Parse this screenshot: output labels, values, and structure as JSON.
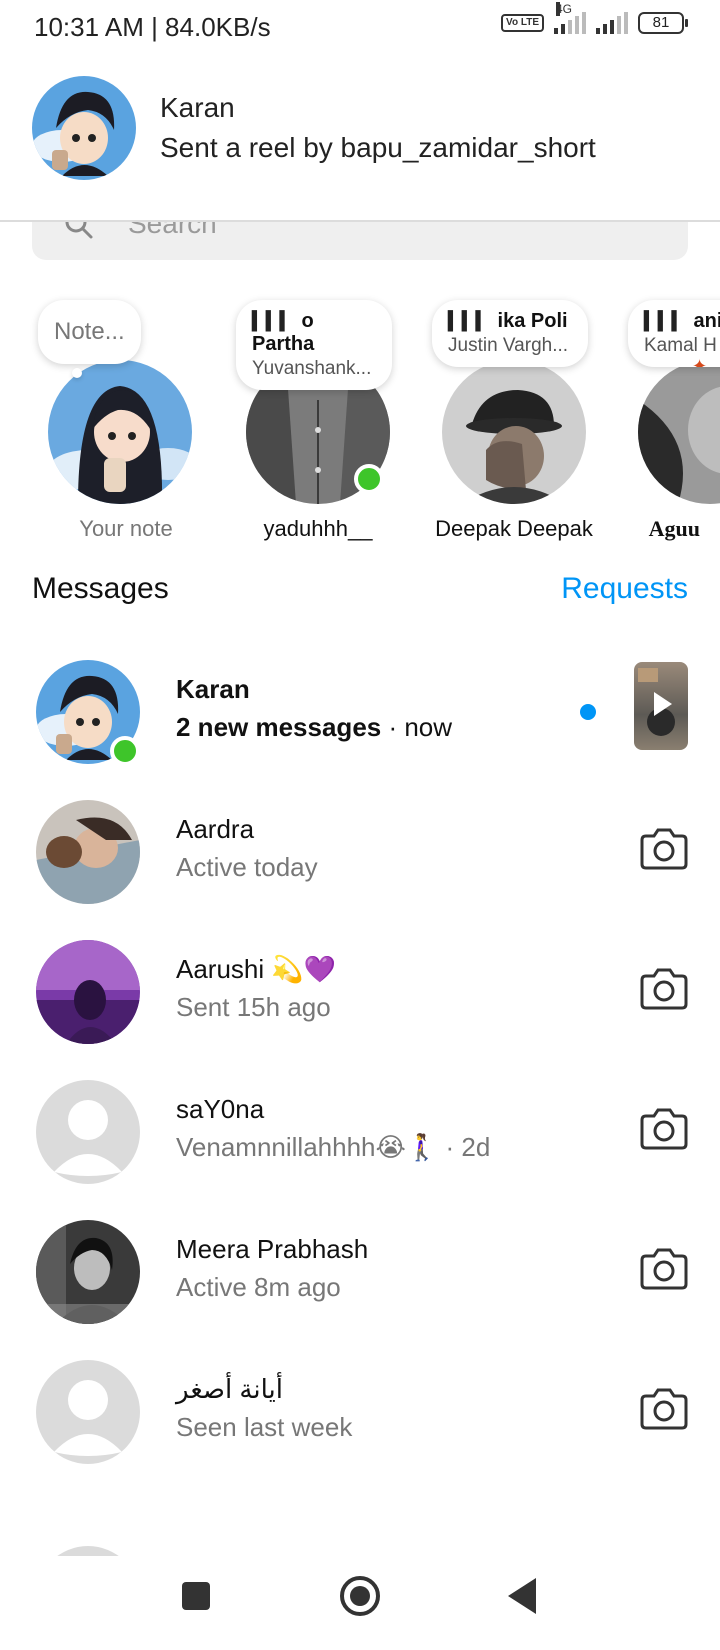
{
  "status_bar": {
    "time": "10:31 AM | 84.0KB/s",
    "network_tag": "4G",
    "volte": "Vo LTE",
    "battery": "81"
  },
  "notification": {
    "name": "Karan",
    "text": "Sent a reel by bapu_zamidar_short"
  },
  "search": {
    "placeholder": "Search"
  },
  "notes": [
    {
      "bubble": "Note...",
      "label": "Your note"
    },
    {
      "song": "o Partha",
      "artist": "Yuvanshank...",
      "label": "yaduhhh__"
    },
    {
      "song": "ika     Poli",
      "artist": "Justin Vargh...",
      "label": "Deepak Deepak"
    },
    {
      "song": "ani Ar",
      "artist": "Kamal H",
      "label": "Aguu"
    }
  ],
  "messages_header": {
    "title": "Messages",
    "requests": "Requests"
  },
  "messages": [
    {
      "name": "Karan",
      "sub_bold": "2 new messages",
      "sub_rest": " · now",
      "unread": true,
      "online": true
    },
    {
      "name": "Aardra",
      "sub": "Active today"
    },
    {
      "name": "Aarushi 💫💜",
      "sub": "Sent 15h ago"
    },
    {
      "name": "saY0na",
      "sub": "Venamnnillahhhh😭🚶‍♀️ · 2d"
    },
    {
      "name": "Meera Prabhash",
      "sub": "Active 8m ago"
    },
    {
      "name": "أيانة أصغر",
      "sub": "Seen last week"
    }
  ],
  "colors": {
    "accent": "#0095f6",
    "online": "#3ec52a",
    "muted": "#777777"
  }
}
